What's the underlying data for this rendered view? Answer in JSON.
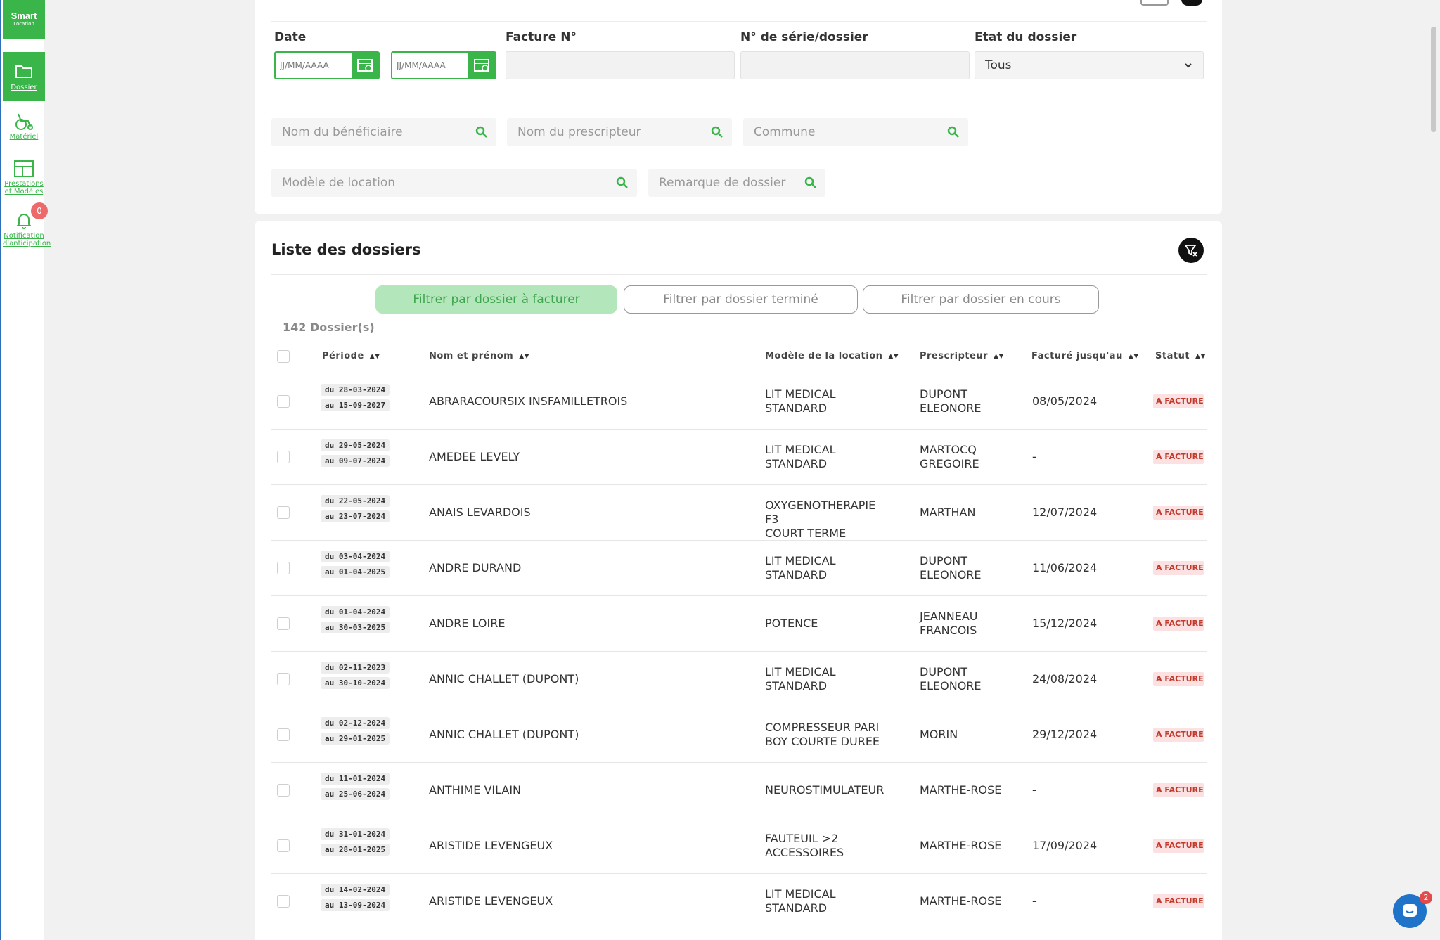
{
  "sidebar": {
    "logo_line1": "Smart",
    "logo_line2": "Location",
    "items": [
      {
        "label": "Dossier",
        "icon": "folder-icon"
      },
      {
        "label": "Matériel",
        "icon": "wheelchair-icon"
      },
      {
        "label": "Prestations et Modèles",
        "label_l1": "Prestations",
        "label_l2": "et Modèles",
        "icon": "layout-grid-icon"
      },
      {
        "label": "Notification d'anticipation",
        "label_l1": "Notification",
        "label_l2": "d'anticipation",
        "icon": "bell-icon",
        "badge": "0"
      }
    ]
  },
  "filters": {
    "date_label": "Date",
    "date_from_placeholder": "JJ/MM/AAAA",
    "date_to_placeholder": "JJ/MM/AAAA",
    "invoice_label": "Facture N°",
    "serial_label": "N° de série/dossier",
    "state_label": "Etat du dossier",
    "state_value": "Tous",
    "beneficiary_placeholder": "Nom du bénéficiaire",
    "prescriber_placeholder": "Nom du prescripteur",
    "commune_placeholder": "Commune",
    "rental_model_placeholder": "Modèle de location",
    "remark_placeholder": "Remarque de dossier"
  },
  "list": {
    "title": "Liste des dossiers",
    "filter_buttons": [
      "Filtrer par dossier à facturer",
      "Filtrer par dossier terminé",
      "Filtrer par dossier en cours"
    ],
    "count": "142 Dossier(s)",
    "columns": [
      "Période",
      "Nom et prénom",
      "Modèle de la location",
      "Prescripteur",
      "Facturé jusqu'au",
      "Statut"
    ],
    "rows": [
      {
        "from": "du 28-03-2024",
        "to": "au 15-09-2027",
        "name": "ABRARACOURSIX INSFAMILLETROIS",
        "model_l1": "LIT MEDICAL",
        "model_l2": "STANDARD",
        "pres_l1": "DUPONT",
        "pres_l2": "ELEONORE",
        "billed": "08/05/2024",
        "status": "A FACTURER"
      },
      {
        "from": "du 29-05-2024",
        "to": "au 09-07-2024",
        "name": "AMEDEE LEVELY",
        "model_l1": "LIT MEDICAL",
        "model_l2": "STANDARD",
        "pres_l1": "MARTOCQ",
        "pres_l2": "GREGOIRE",
        "billed": "-",
        "status": "A FACTURER"
      },
      {
        "from": "du 22-05-2024",
        "to": "au 23-07-2024",
        "name": "ANAIS LEVARDOIS",
        "model_l1": "OXYGENOTHERAPIE F3",
        "model_l2": "COURT TERME",
        "pres_l1": "MARTHAN",
        "pres_l2": "",
        "billed": "12/07/2024",
        "status": "A FACTURER"
      },
      {
        "from": "du 03-04-2024",
        "to": "au 01-04-2025",
        "name": "ANDRE DURAND",
        "model_l1": "LIT MEDICAL",
        "model_l2": "STANDARD",
        "pres_l1": "DUPONT",
        "pres_l2": "ELEONORE",
        "billed": "11/06/2024",
        "status": "A FACTURER"
      },
      {
        "from": "du 01-04-2024",
        "to": "au 30-03-2025",
        "name": "ANDRE LOIRE",
        "model_l1": "POTENCE",
        "model_l2": "",
        "pres_l1": "JEANNEAU",
        "pres_l2": "FRANCOIS",
        "billed": "15/12/2024",
        "status": "A FACTURER"
      },
      {
        "from": "du 02-11-2023",
        "to": "au 30-10-2024",
        "name": "ANNIC CHALLET (DUPONT)",
        "model_l1": "LIT MEDICAL",
        "model_l2": "STANDARD",
        "pres_l1": "DUPONT",
        "pres_l2": "ELEONORE",
        "billed": "24/08/2024",
        "status": "A FACTURER"
      },
      {
        "from": "du 02-12-2024",
        "to": "au 29-01-2025",
        "name": "ANNIC CHALLET (DUPONT)",
        "model_l1": "COMPRESSEUR PARI",
        "model_l2": "BOY COURTE DUREE",
        "pres_l1": "MORIN",
        "pres_l2": "",
        "billed": "29/12/2024",
        "status": "A FACTURER"
      },
      {
        "from": "du 11-01-2024",
        "to": "au 25-06-2024",
        "name": "ANTHIME VILAIN",
        "model_l1": "NEUROSTIMULATEUR",
        "model_l2": "",
        "pres_l1": "MARTHE-ROSE",
        "pres_l2": "",
        "billed": "-",
        "status": "A FACTURER"
      },
      {
        "from": "du 31-01-2024",
        "to": "au 28-01-2025",
        "name": "ARISTIDE LEVENGEUX",
        "model_l1": "FAUTEUIL >2",
        "model_l2": "ACCESSOIRES",
        "pres_l1": "MARTHE-ROSE",
        "pres_l2": "",
        "billed": "17/09/2024",
        "status": "A FACTURER"
      },
      {
        "from": "du 14-02-2024",
        "to": "au 13-09-2024",
        "name": "ARISTIDE LEVENGEUX",
        "model_l1": "LIT MEDICAL",
        "model_l2": "STANDARD",
        "pres_l1": "MARTHE-ROSE",
        "pres_l2": "",
        "billed": "-",
        "status": "A FACTURER"
      }
    ]
  },
  "chat": {
    "badge": "2"
  },
  "colors": {
    "brand_green": "#39b54a",
    "status_bg": "#fbe1e1",
    "status_text": "#c0392b"
  }
}
